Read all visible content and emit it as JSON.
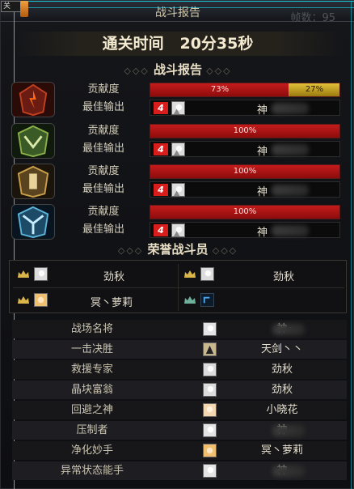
{
  "window": {
    "title": "战斗报告",
    "frame_count": "帧数：95",
    "close_label": "关"
  },
  "clear_time": {
    "label": "通关时间",
    "value": "20分35秒"
  },
  "battle_report": {
    "heading": "战斗报告",
    "contribution_label": "贡献度",
    "best_output_label": "最佳输出",
    "players": [
      {
        "emblem": "fire-class-emblem-icon",
        "contribution_pct": 73,
        "contribution_text": "73%",
        "secondary_pct": 27,
        "secondary_text": "27%",
        "best_output_icon": "skill-4-icon",
        "best_output_name": "神"
      },
      {
        "emblem": "green-class-emblem-icon",
        "contribution_pct": 100,
        "contribution_text": "100%",
        "best_output_icon": "skill-4-icon",
        "best_output_name": "神"
      },
      {
        "emblem": "gold-class-emblem-icon",
        "contribution_pct": 100,
        "contribution_text": "100%",
        "best_output_icon": "skill-4-icon",
        "best_output_name": "神"
      },
      {
        "emblem": "ice-class-emblem-icon",
        "contribution_pct": 100,
        "contribution_text": "100%",
        "best_output_icon": "skill-4-icon",
        "best_output_name": "神"
      }
    ]
  },
  "honor": {
    "heading": "荣誉战斗员",
    "members": [
      {
        "crown": "gold-crown-icon",
        "name": "劲秋"
      },
      {
        "crown": "gold-crown-icon",
        "name": "劲秋"
      },
      {
        "crown": "gold-crown-icon",
        "name": "冥丶萝莉"
      },
      {
        "crown": "green-crown-icon",
        "name": ""
      }
    ]
  },
  "awards": [
    {
      "title": "战场名将",
      "player": "神"
    },
    {
      "title": "一击决胜",
      "player": "天剑丶丶"
    },
    {
      "title": "救援专家",
      "player": "劲秋"
    },
    {
      "title": "晶块富翁",
      "player": "劲秋"
    },
    {
      "title": "回避之神",
      "player": "小晓花"
    },
    {
      "title": "压制者",
      "player": "神"
    },
    {
      "title": "净化妙手",
      "player": "冥丶萝莉"
    },
    {
      "title": "异常状态能手",
      "player": "神"
    }
  ],
  "colors": {
    "bar_red": "#c51b1b",
    "bar_gold": "#e4c13a",
    "accent_cyan": "#19c7d8"
  }
}
